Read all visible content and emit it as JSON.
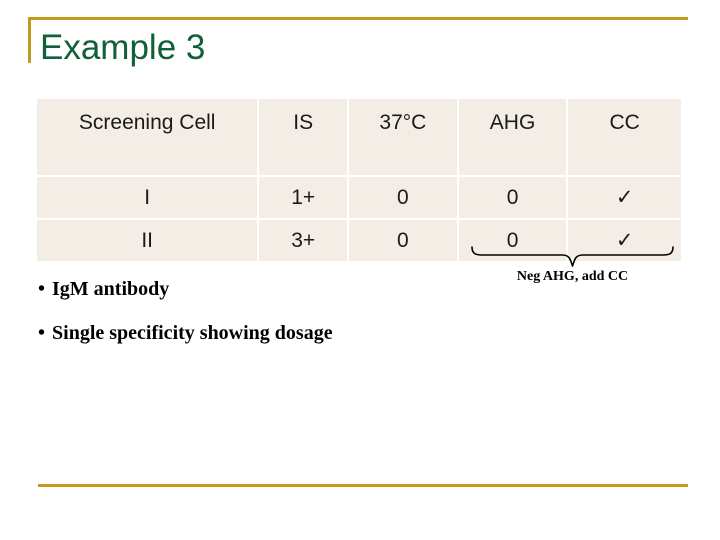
{
  "slide": {
    "title": "Example 3",
    "accent_gold": "#BF9C1E",
    "title_green": "#10603A",
    "cell_fill": "#F4EDE6"
  },
  "table": {
    "columns": [
      "Screening Cell",
      "IS",
      "37°C",
      "AHG",
      "CC"
    ],
    "rows": [
      {
        "cell": "I",
        "is": "1+",
        "t37": "0",
        "ahg": "0",
        "cc": "✓"
      },
      {
        "cell": "II",
        "is": "3+",
        "t37": "0",
        "ahg": "0",
        "cc": "✓"
      }
    ]
  },
  "annotation": {
    "brace_label": "Neg AHG, add CC"
  },
  "bullets": [
    {
      "marker": "•",
      "text": "IgM antibody"
    },
    {
      "marker": "•",
      "text": "Single specificity showing dosage"
    }
  ]
}
